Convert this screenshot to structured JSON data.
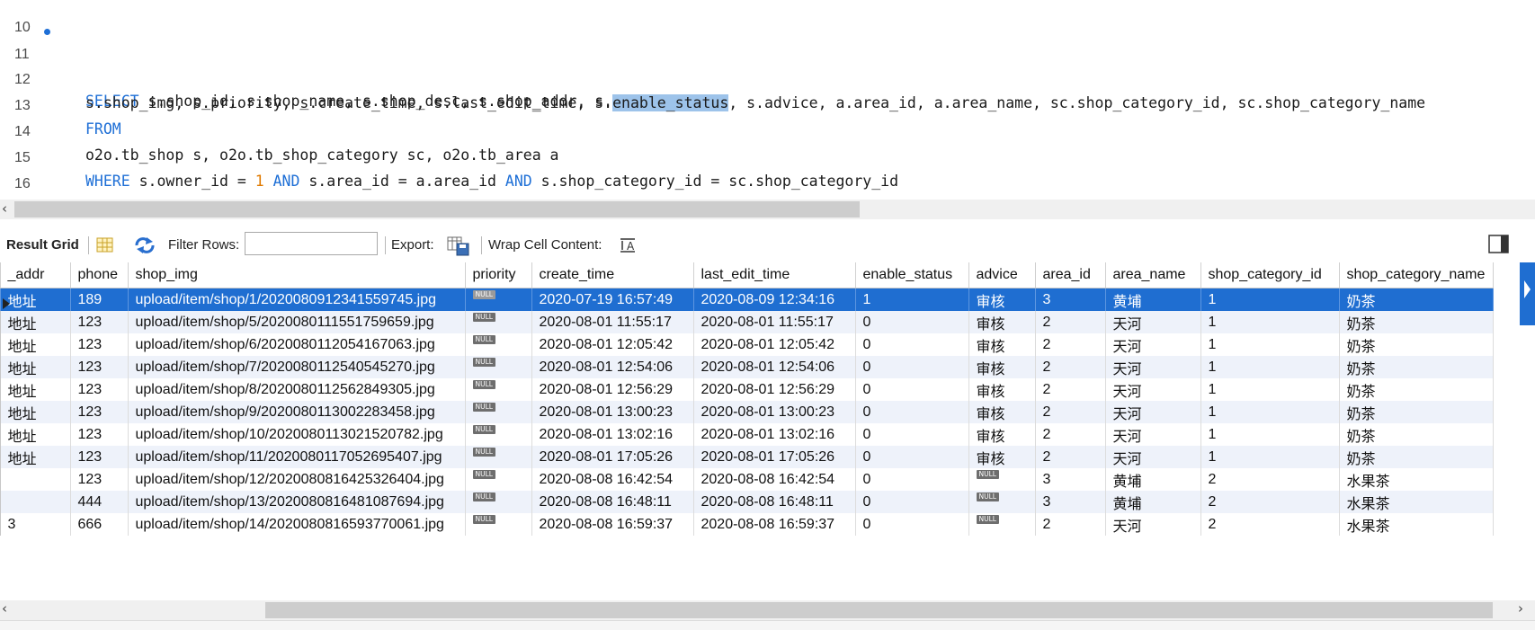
{
  "editor": {
    "lines": [
      {
        "num": "10"
      },
      {
        "num": "11"
      },
      {
        "num": "12"
      },
      {
        "num": "13"
      },
      {
        "num": "14"
      },
      {
        "num": "15"
      },
      {
        "num": "16"
      }
    ],
    "l11": {
      "kw": "SELECT",
      "rest": " s.shop_id, s.shop_name, s.shop_desc, s.shop_addr, s.phone,"
    },
    "l12": {
      "pre": "s.shop_img, s.priority, s.create_time, s.last_edit_time, s.",
      "hl": "enable_status",
      "post": ", s.advice, a.area_id, a.area_name, sc.shop_category_id, sc.shop_category_name"
    },
    "l13": {
      "kw": "FROM"
    },
    "l14": {
      "text": "o2o.tb_shop s, o2o.tb_shop_category sc, o2o.tb_area a"
    },
    "l15": {
      "kw1": "WHERE",
      "t1": " s.owner_id = ",
      "num": "1",
      "sp": " ",
      "kw2": "AND",
      "t2": " s.area_id = a.area_id ",
      "kw3": "AND",
      "t3": " s.shop_category_id = sc.shop_category_id"
    }
  },
  "toolbar": {
    "result_grid": "Result Grid",
    "filter_rows": "Filter Rows:",
    "filter_value": "",
    "export": "Export:",
    "wrap": "Wrap Cell Content:"
  },
  "grid": {
    "columns": [
      "_addr",
      "phone",
      "shop_img",
      "priority",
      "create_time",
      "last_edit_time",
      "enable_status",
      "advice",
      "area_id",
      "area_name",
      "shop_category_id",
      "shop_category_name"
    ],
    "null_label": "NULL",
    "rows": [
      {
        "addr": "地址",
        "phone": "189",
        "img": "upload/item/shop/1/2020080912341559745.jpg",
        "create": "2020-07-19 16:57:49",
        "edit": "2020-08-09 12:34:16",
        "status": "1",
        "advice": "审核",
        "area_id": "3",
        "area_name": "黄埔",
        "cat_id": "1",
        "cat_name": "奶茶"
      },
      {
        "addr": "地址",
        "phone": "123",
        "img": "upload/item/shop/5/2020080111551759659.jpg",
        "create": "2020-08-01 11:55:17",
        "edit": "2020-08-01 11:55:17",
        "status": "0",
        "advice": "审核",
        "area_id": "2",
        "area_name": "天河",
        "cat_id": "1",
        "cat_name": "奶茶"
      },
      {
        "addr": "地址",
        "phone": "123",
        "img": "upload/item/shop/6/2020080112054167063.jpg",
        "create": "2020-08-01 12:05:42",
        "edit": "2020-08-01 12:05:42",
        "status": "0",
        "advice": "审核",
        "area_id": "2",
        "area_name": "天河",
        "cat_id": "1",
        "cat_name": "奶茶"
      },
      {
        "addr": "地址",
        "phone": "123",
        "img": "upload/item/shop/7/2020080112540545270.jpg",
        "create": "2020-08-01 12:54:06",
        "edit": "2020-08-01 12:54:06",
        "status": "0",
        "advice": "审核",
        "area_id": "2",
        "area_name": "天河",
        "cat_id": "1",
        "cat_name": "奶茶"
      },
      {
        "addr": "地址",
        "phone": "123",
        "img": "upload/item/shop/8/2020080112562849305.jpg",
        "create": "2020-08-01 12:56:29",
        "edit": "2020-08-01 12:56:29",
        "status": "0",
        "advice": "审核",
        "area_id": "2",
        "area_name": "天河",
        "cat_id": "1",
        "cat_name": "奶茶"
      },
      {
        "addr": "地址",
        "phone": "123",
        "img": "upload/item/shop/9/2020080113002283458.jpg",
        "create": "2020-08-01 13:00:23",
        "edit": "2020-08-01 13:00:23",
        "status": "0",
        "advice": "审核",
        "area_id": "2",
        "area_name": "天河",
        "cat_id": "1",
        "cat_name": "奶茶"
      },
      {
        "addr": "地址",
        "phone": "123",
        "img": "upload/item/shop/10/2020080113021520782.jpg",
        "create": "2020-08-01 13:02:16",
        "edit": "2020-08-01 13:02:16",
        "status": "0",
        "advice": "审核",
        "area_id": "2",
        "area_name": "天河",
        "cat_id": "1",
        "cat_name": "奶茶"
      },
      {
        "addr": "地址",
        "phone": "123",
        "img": "upload/item/shop/11/2020080117052695407.jpg",
        "create": "2020-08-01 17:05:26",
        "edit": "2020-08-01 17:05:26",
        "status": "0",
        "advice": "审核",
        "area_id": "2",
        "area_name": "天河",
        "cat_id": "1",
        "cat_name": "奶茶"
      },
      {
        "addr": "",
        "phone": "123",
        "img": "upload/item/shop/12/2020080816425326404.jpg",
        "create": "2020-08-08 16:42:54",
        "edit": "2020-08-08 16:42:54",
        "status": "0",
        "advice": null,
        "area_id": "3",
        "area_name": "黄埔",
        "cat_id": "2",
        "cat_name": "水果茶"
      },
      {
        "addr": "",
        "phone": "444",
        "img": "upload/item/shop/13/2020080816481087694.jpg",
        "create": "2020-08-08 16:48:11",
        "edit": "2020-08-08 16:48:11",
        "status": "0",
        "advice": null,
        "area_id": "3",
        "area_name": "黄埔",
        "cat_id": "2",
        "cat_name": "水果茶"
      },
      {
        "addr": "3",
        "phone": "666",
        "img": "upload/item/shop/14/2020080816593770061.jpg",
        "create": "2020-08-08 16:59:37",
        "edit": "2020-08-08 16:59:37",
        "status": "0",
        "advice": null,
        "area_id": "2",
        "area_name": "天河",
        "cat_id": "2",
        "cat_name": "水果茶"
      }
    ]
  },
  "colors": {
    "keyword": "#1e6fd6",
    "number": "#e07a00",
    "selection": "#1f6ed1",
    "highlight": "#9dc3ea",
    "alt_row": "#eef2fa"
  }
}
